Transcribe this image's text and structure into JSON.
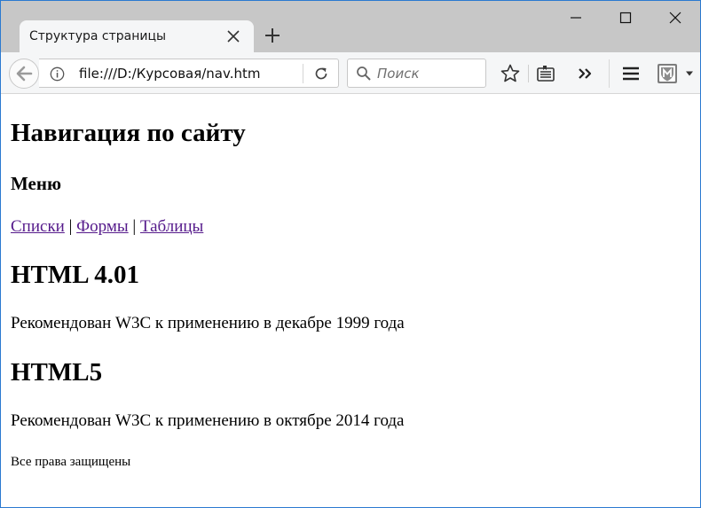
{
  "window": {
    "tab_title": "Структура страницы"
  },
  "navbar": {
    "url": "file:///D:/Курсовая/nav.htm",
    "search_placeholder": "Поиск"
  },
  "page": {
    "h1": "Навигация по сайту",
    "menu_heading": "Меню",
    "links": [
      {
        "label": "Списки"
      },
      {
        "label": "Формы"
      },
      {
        "label": "Таблицы"
      }
    ],
    "link_separator": "|",
    "sections": [
      {
        "heading": "HTML 4.01",
        "text": "Рекомендован W3C к применению в декабре 1999 года"
      },
      {
        "heading": "HTML5",
        "text": "Рекомендован W3C к применению в октябре 2014 года"
      }
    ],
    "footer": "Все права защищены"
  },
  "colors": {
    "visited_link": "#551a8b",
    "window_border": "#2b79d0",
    "tabstrip": "#c7c7c7",
    "toolbar": "#f5f6f7"
  }
}
